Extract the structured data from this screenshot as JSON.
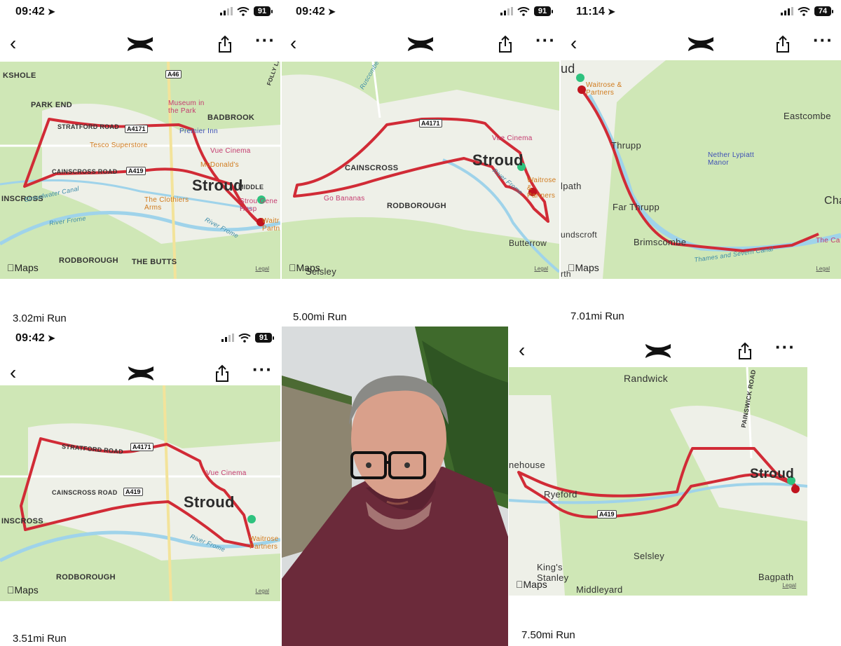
{
  "panels": [
    {
      "time": "09:42",
      "battery": "91",
      "run": "3.02mi Run",
      "labels": [
        "KSHOLE",
        "PARK END",
        "BADBROOK",
        "INSCROSS",
        "RODBOROUGH",
        "THE BUTTS",
        "MIDDLE"
      ],
      "roads": [
        "STRATFORD ROAD",
        "CAINSCROSS ROAD",
        "A46",
        "A4171",
        "A419",
        "FOLLY LA"
      ],
      "town": "Stroud",
      "pois": [
        "Museum in the Park",
        "Vue Cinema",
        "Strou Gene Hosp"
      ],
      "blue_pois": [
        "Premier Inn"
      ],
      "food": [
        "Tesco Superstore",
        "McDonald's",
        "The Clothiers Arms",
        "Waitr Partn"
      ],
      "water": [
        "Stroudwater Canal",
        "River Frome",
        "River Frome"
      ]
    },
    {
      "time": "09:42",
      "battery": "91",
      "run": "5.00mi Run",
      "labels": [
        "CAINSCROSS",
        "RODBOROUGH",
        "Butterrow",
        "Selsley"
      ],
      "roads": [
        "A4171",
        "Ruscombe B"
      ],
      "town": "Stroud",
      "pois": [
        "Vue Cinema",
        "Go Bananas"
      ],
      "food": [
        "Waitrose & Partners"
      ],
      "water": [
        "River Frome"
      ]
    },
    {
      "time": "11:14",
      "battery": "74",
      "run": "7.01mi Run",
      "labels": [
        "ud",
        "Eastcombe",
        "Thrupp",
        "Far Thrupp",
        "Brimscombe",
        "undscroft",
        "lpath",
        "Cha",
        "rth"
      ],
      "pois": [
        "The Ca"
      ],
      "blue_pois": [
        "Nether Lypiatt Manor"
      ],
      "food": [
        "Waitrose & Partners"
      ],
      "water": [
        "Thames and Severn Canal"
      ]
    },
    {
      "time": "09:42",
      "battery": "91",
      "run": "3.51mi Run",
      "labels": [
        "INSCROSS",
        "RODBOROUGH"
      ],
      "roads": [
        "STRATFORD ROAD",
        "CAINSCROSS ROAD",
        "A4171",
        "A419"
      ],
      "town": "Stroud",
      "pois": [
        "Vue Cinema"
      ],
      "food": [
        "Waitrose Partners"
      ],
      "water": [
        "River Frome"
      ]
    },
    {
      "run": "7.50mi Run",
      "labels": [
        "Randwick",
        "nehouse",
        "Ryeford",
        "Selsley",
        "King's Stanley",
        "Middleyard",
        "Bagpath"
      ],
      "roads": [
        "PAINSWICK ROAD",
        "A419"
      ],
      "town": "Stroud"
    }
  ],
  "map_brand": "Maps",
  "legal": "Legal",
  "icons": [
    "back-icon",
    "under-armour-logo-icon",
    "share-icon",
    "more-icon",
    "location-arrow-icon",
    "signal-icon",
    "wifi-icon",
    "battery-icon"
  ],
  "colors": {
    "route": "#d12b36",
    "start": "#2ec27e",
    "end": "#c0141e",
    "map_green": "#cfe7b6",
    "map_urban": "#eef0e8",
    "water": "#9fd3ea",
    "shirt": "#6b2a3a"
  }
}
